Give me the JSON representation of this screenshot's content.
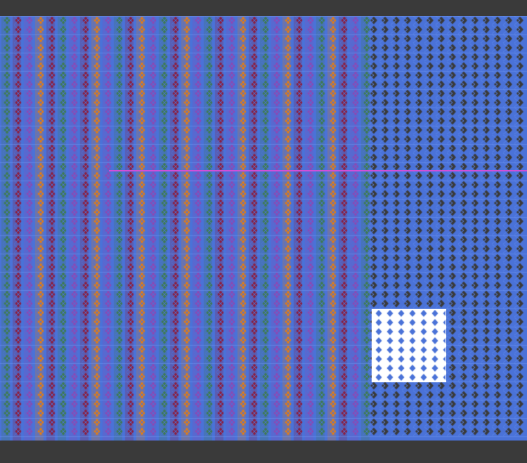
{
  "editor": {
    "pattern": {
      "colors": {
        "warp_blue": "#4a72d8",
        "weft_dark": "#3a3a3a",
        "orange": "#e07d18",
        "maroon": "#8c1f40",
        "green": "#3f7b52",
        "purple": "#8a4ab5",
        "selection_bg": "#ffffff",
        "guide_magenta": "#d24fd8"
      },
      "stripe_sequence": [
        "green",
        "maroon",
        "purple",
        "orange",
        "maroon",
        "green",
        "purple",
        "maroon",
        "orange",
        "purple",
        "green",
        "maroon",
        "orange",
        "purple",
        "green",
        "maroon",
        "orange",
        "purple",
        "green",
        "maroon",
        "purple",
        "orange",
        "maroon",
        "green",
        "purple",
        "orange",
        "maroon",
        "purple",
        "green",
        "orange",
        "maroon",
        "purple"
      ],
      "motif": "diamond-lattice"
    }
  }
}
